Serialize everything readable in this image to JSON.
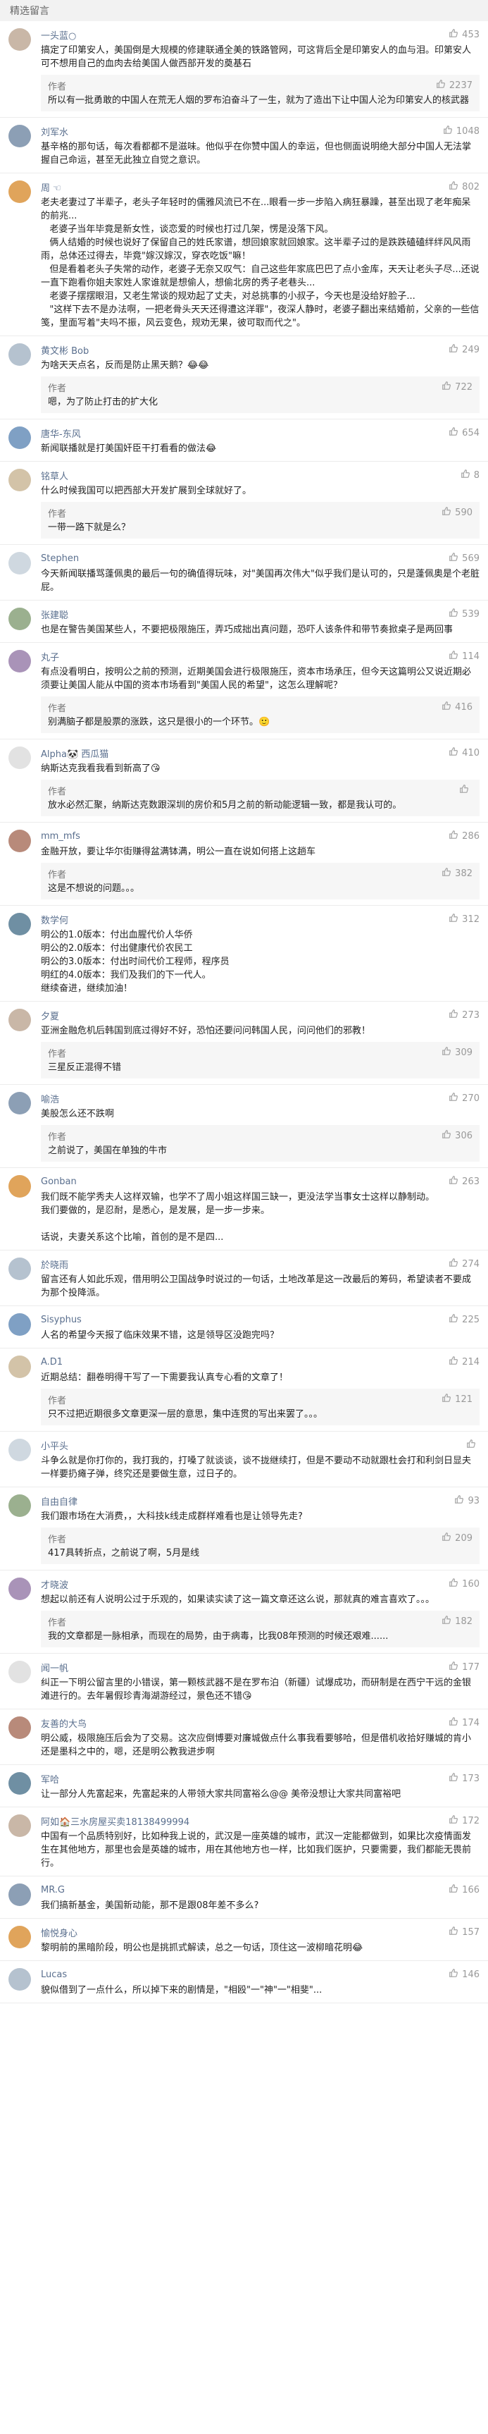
{
  "header": {
    "title": "精选留言"
  },
  "comments": [
    {
      "name": "一头蓝○",
      "likes": "453",
      "text": "搞定了印第安人，美国倒是大规模的修建联通全美的铁路管网，可这背后全是印第安人的血与泪。印第安人可不想用自己的血肉去给美国人做西部开发的奠基石",
      "reply": {
        "name": "作者",
        "likes": "2237",
        "text": "所以有一批勇敢的中国人在荒无人烟的罗布泊奋斗了一生，就为了造出下让中国人沦为印第安人的核武器"
      }
    },
    {
      "name": "刘军水",
      "likes": "1048",
      "text": "基辛格的那句话，每次看都都不是滋味。他似乎在你赞中国人的幸运，但也侧面说明绝大部分中国人无法掌握自己命运，甚至无此独立自觉之意识。"
    },
    {
      "name": "周 ☜",
      "likes": "802",
      "text": "老夫老妻过了半辈子，老头子年轻时的儒雅风流已不在...眼看一步一步陷入病狂暴躁，甚至出现了老年痴呆的前兆...\n   老婆子当年毕竟是新女性，谈恋爱的时候也打过几架，愣是没落下风。\n   俩人结婚的时候也说好了保留自己的姓氏家谱，想回娘家就回娘家。这半辈子过的是跌跌磕磕绊绊风风雨雨，总体还过得去，毕竟\"嫁汉嫁汉，穿衣吃饭\"嘛！\n   但是看着老头子失常的动作，老婆子无奈又叹气：自己这些年家底巴巴了点小金库，天天让老头子尽...还说一直下跑看你姐夫家姓人家谁就是想偷人，想偷北房的秀子老巷头...\n   老婆子摆摆眼泪，又老生常谈的规劝起了丈夫，对总挑事的小叔子，今天也是没给好脸子...\n   \"这样下去不是办法啊，一把老骨头天天还得遭这洋罪\"，夜深人静时，老婆子翻出来结婚前，父亲的一些信笺，里面写着\"夫吗不振，风云变色，规劝无果，彼可取而代之\"。"
    },
    {
      "name": "黄文彬 Bob",
      "likes": "249",
      "text": "为啥天天点名，反而是防止黑天鹅？😂😂",
      "reply": {
        "name": "作者",
        "likes": "722",
        "text": "嗯，为了防止打击的扩大化"
      }
    },
    {
      "name": "唐华-东风",
      "likes": "654",
      "text": "新闻联播就是打美国奸臣干打看看的做法😂"
    },
    {
      "name": "铭草人",
      "likes": "8",
      "text": "什么时候我国可以把西部大开发扩展到全球就好了。",
      "reply": {
        "name": "作者",
        "likes": "590",
        "text": "一带一路下就是么？"
      }
    },
    {
      "name": "Stephen",
      "likes": "569",
      "text": "今天新闻联播骂蓬佩奥的最后一句的确值得玩味，对\"美国再次伟大\"似乎我们是认可的，只是蓬佩奥是个老脏屁。"
    },
    {
      "name": "张建聪",
      "likes": "539",
      "text": "也是在警告美国某些人，不要把极限施压，弄巧成拙出真问题，恐吓人该条件和带节奏掀桌子是两回事"
    },
    {
      "name": "丸子",
      "likes": "114",
      "text": "有点没看明白，按明公之前的预测，近期美国会进行极限施压，资本市场承压，但今天这篇明公又说近期必须要让美国人能从中国的资本市场看到\"美国人民的希望\"，这怎么理解呢？",
      "reply": {
        "name": "作者",
        "likes": "416",
        "text": "别满脑子都是股票的涨跌，这只是很小的一个环节。🙂"
      }
    },
    {
      "name": "Alpha🐼 西瓜猫",
      "likes": "410",
      "text": "纳斯达克我看我看到新高了😘",
      "reply": {
        "name": "作者",
        "likes": "",
        "text": "放水必然汇聚，纳斯达克数跟深圳的房价和5月之前的新动能逻辑一致，都是我认可的。"
      }
    },
    {
      "name": "mm_mfs",
      "likes": "286",
      "text": "金融开放，要让华尔街赚得盆满钵满，明公一直在说如何搭上这趟车",
      "reply": {
        "name": "作者",
        "likes": "382",
        "text": "这是不想说的问题。。。"
      }
    },
    {
      "name": "数学何",
      "likes": "312",
      "text": "明公的1.0版本：付出血腥代价人华侨\n明公的2.0版本：付出健康代价农民工\n明公的3.0版本：付出时间代价工程师，程序员\n明红的4.0版本：我们及我们的下一代人。\n继续奋进，继续加油！"
    },
    {
      "name": "夕夏",
      "likes": "273",
      "text": "亚洲金融危机后韩国到底过得好不好，恐怕还要问问韩国人民，问问他们的邪教！",
      "reply": {
        "name": "作者",
        "likes": "309",
        "text": "三星反正混得不错"
      }
    },
    {
      "name": "喻浩",
      "likes": "270",
      "text": "美股怎么还不跌啊",
      "reply": {
        "name": "作者",
        "likes": "306",
        "text": "之前说了，美国在单独的牛市"
      }
    },
    {
      "name": "Gonban",
      "likes": "263",
      "text": "我们既不能学秀夫人这样双输，也学不了周小姐这样国三缺一，更没法学当事女士这样以静制动。\n我们要做的，是忍耐，是悉心，是发展，是一步一步来。\n\n话说，夫妻关系这个比喻，首创的是不是四..."
    },
    {
      "name": "於晓雨",
      "likes": "274",
      "text": "留言还有人如此乐观，借用明公卫国战争时说过的一句话，土地改革是这一改最后的筹码，希望读者不要成为那个投降派。"
    },
    {
      "name": "Sisyphus",
      "likes": "225",
      "text": "人名的希望今天报了临床效果不错，这是领导区没跑完吗？"
    },
    {
      "name": "A.D1",
      "likes": "214",
      "text": "近期总结：翻卷明得干写了一下需要我认真专心看的文章了！",
      "reply": {
        "name": "作者",
        "likes": "121",
        "text": "只不过把近期很多文章更深一层的意思，集中连贯的写出来罢了。。。"
      }
    },
    {
      "name": "小平头",
      "likes": "",
      "text": "斗争么就是你打你的，我打我的，打嗓了就谈谈，谈不拢继续打，但是不要动不动就跟杜会打和利剑日显夫一样要扔瘫子弹，终究还是要做生意，过日子的。"
    },
    {
      "name": "自由自律",
      "likes": "93",
      "text": "我们跟市场在大消费，，大科技k线走成群样难看也是让领导先走?",
      "reply": {
        "name": "作者",
        "likes": "209",
        "text": "417具转折点，之前说了啊，5月是线"
      }
    },
    {
      "name": "才晓波",
      "likes": "160",
      "text": "想起以前还有人说明公过于乐观的，如果读实读了这一篇文章还这么说，那就真的难言喜欢了。。。",
      "reply": {
        "name": "作者",
        "likes": "182",
        "text": "我的文章都是一脉相承，而现在的局势，由于病毒，比我08年预测的时候还艰难......"
      }
    },
    {
      "name": "闻一帆",
      "likes": "177",
      "text": "纠正一下明公留言里的小错误，第一颗核武器不是在罗布泊（新疆）试爆成功，而研制是在西宁干远的金银滩进行的。去年暑假珍青海湖游经过，景色还不错😘"
    },
    {
      "name": "友善的大鸟",
      "likes": "174",
      "text": "明公威，极限施压后会为了交易。这次应倒博要对廉城做点什么事我看要够哈，但是借机收拾好赚城的肯小还是墨科之中的，嗯，还是明公教我进步啊"
    },
    {
      "name": "军哈",
      "likes": "173",
      "text": "让一部分人先富起来，先富起来的人带领大家共同富裕么@@ 美帝没想让大家共同富裕吧"
    },
    {
      "name": "阿如🏠三水房屋买卖18138499994",
      "likes": "172",
      "text": "中国有一个品质特别好，比如种我上说的，武汉是一座英雄的城市，武汉一定能都做到，如果比次疫情面发生在其他地方，那里也会是英雄的城市，用在其他地方也一样，比如我们医护，只要需要，我们都能无畏前行。"
    },
    {
      "name": "MR.G",
      "likes": "166",
      "text": "我们搞新基金，美国新动能，那不是跟08年差不多么?"
    },
    {
      "name": "愉悦身心",
      "likes": "157",
      "text": "黎明前的黑暗阶段，明公也是挑抓式解读，总之一句话，顶住这一波柳暗花明😂"
    },
    {
      "name": "Lucas",
      "likes": "146",
      "text": "貌似借到了一点什么，所以掉下来的剧情是，\"相殴\"一\"神\"一\"相斐\"..."
    }
  ]
}
